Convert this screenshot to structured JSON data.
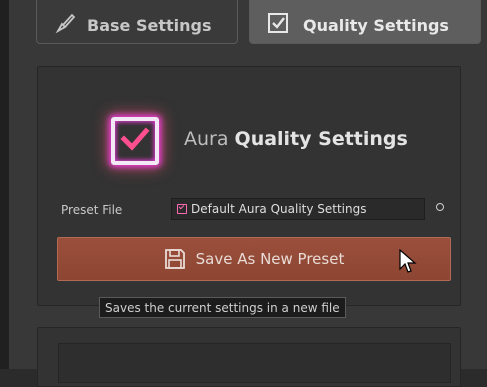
{
  "tabs": [
    {
      "label": "Base Settings",
      "icon": "brush-icon",
      "active": false
    },
    {
      "label": "Quality Settings",
      "icon": "checkbox-icon",
      "active": true
    }
  ],
  "header": {
    "title_prefix": "Aura",
    "title_main": "Quality Settings",
    "logo_icon": "checkbox-logo-icon"
  },
  "preset": {
    "label": "Preset File",
    "value": "Default Aura Quality Settings",
    "value_icon": "preset-asset-icon"
  },
  "save_button": {
    "label": "Save As New Preset",
    "icon": "floppy-disk-icon"
  },
  "tooltip": {
    "text": "Saves the current settings in a new file"
  },
  "colors": {
    "button_bg": "#8d4633",
    "logo_glow": "#e93bd8",
    "panel_bg": "#383838"
  }
}
